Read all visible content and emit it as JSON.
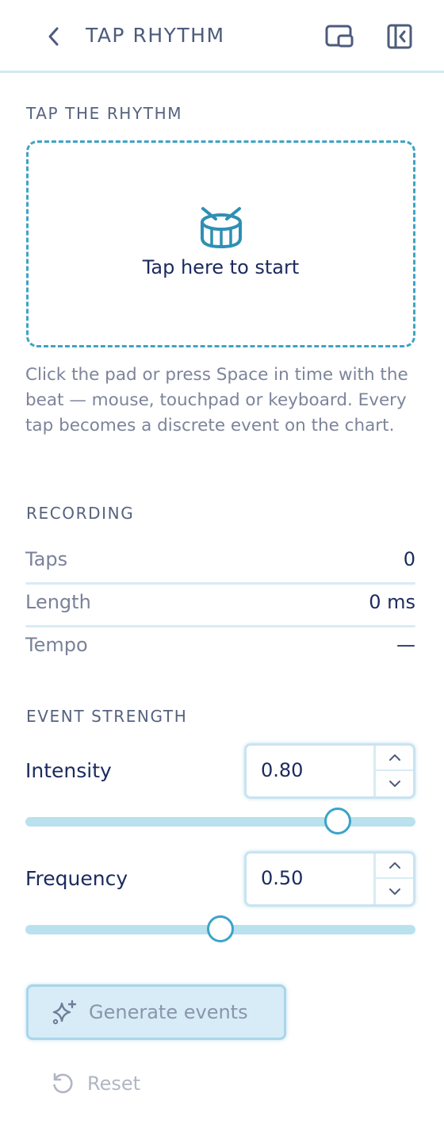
{
  "header": {
    "title": "TAP RHYTHM",
    "back_icon": "chevron-left-icon",
    "pip_icon": "picture-in-picture-icon",
    "collapse_icon": "collapse-panel-icon"
  },
  "tap_section": {
    "label": "TAP THE RHYTHM",
    "pad_icon": "drum-icon",
    "pad_text": "Tap here to start",
    "help": "Click the pad or press Space in time with the beat — mouse, touchpad or keyboard. Every tap becomes a discrete event on the chart."
  },
  "recording": {
    "label": "RECORDING",
    "rows": [
      {
        "key": "Taps",
        "value": "0"
      },
      {
        "key": "Length",
        "value": "0 ms"
      },
      {
        "key": "Tempo",
        "value": "—"
      }
    ]
  },
  "event_strength": {
    "label": "EVENT STRENGTH",
    "intensity": {
      "label": "Intensity",
      "value": "0.80",
      "level": 0.8
    },
    "frequency": {
      "label": "Frequency",
      "value": "0.50",
      "level": 0.5
    }
  },
  "actions": {
    "generate_label": "Generate events",
    "generate_icon": "sparkles-icon",
    "reset_label": "Reset",
    "reset_icon": "reset-icon"
  },
  "colors": {
    "accent": "#3ea3c6",
    "text_dark": "#1b2a5e",
    "muted": "#7a8299",
    "track": "#b9e1ee"
  }
}
